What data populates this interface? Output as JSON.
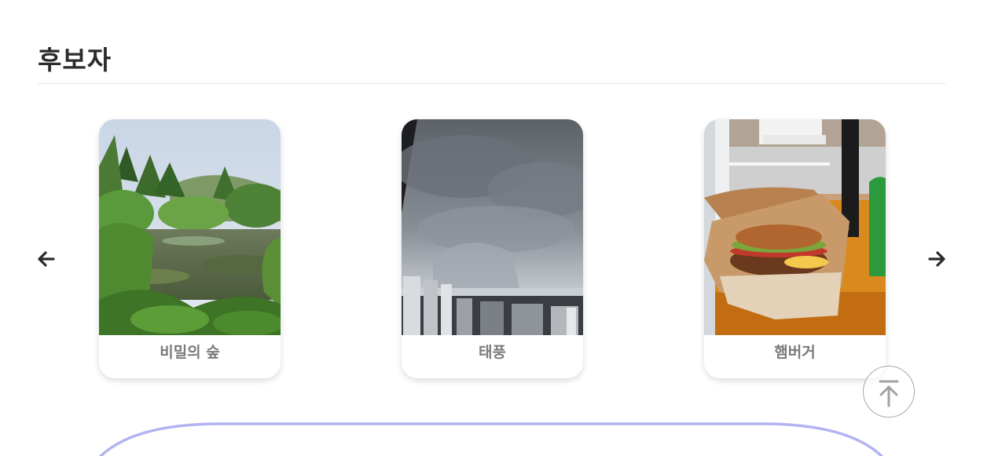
{
  "section": {
    "title": "후보자"
  },
  "carousel": {
    "prev_icon": "arrow-left-icon",
    "next_icon": "arrow-right-icon",
    "cards": [
      {
        "label": "비밀의 숲",
        "image": "forest-pond-photo"
      },
      {
        "label": "태풍",
        "image": "storm-clouds-city-photo"
      },
      {
        "label": "햄버거",
        "image": "hamburger-photo"
      }
    ]
  },
  "scroll_top": {
    "icon": "arrow-up-to-top-icon"
  },
  "colors": {
    "title": "#2b2b2b",
    "card_label": "#7a7a7a",
    "accent_arc": "#b3b3f2",
    "divider": "#e2e2e2"
  }
}
